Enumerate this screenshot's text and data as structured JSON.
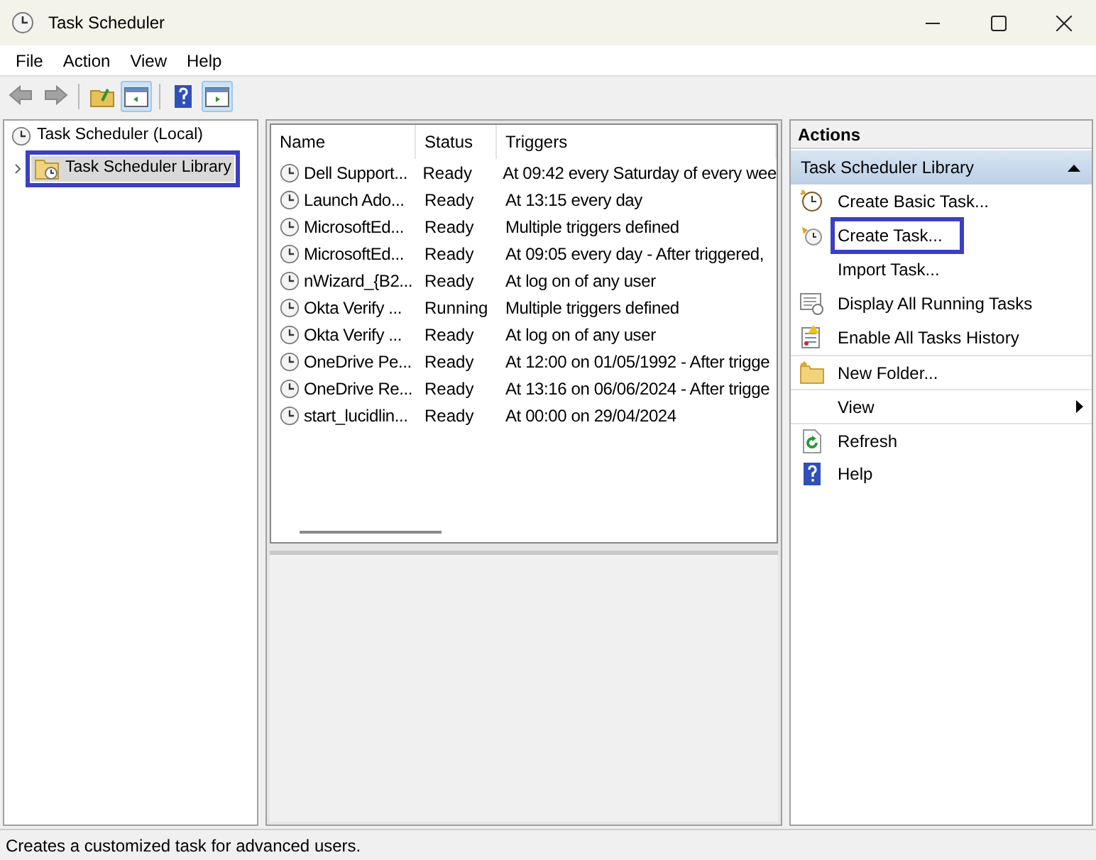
{
  "window": {
    "title": "Task Scheduler"
  },
  "menu": [
    "File",
    "Action",
    "View",
    "Help"
  ],
  "toolbar": [
    {
      "kind": "back",
      "disabled": true
    },
    {
      "kind": "forward",
      "disabled": true
    },
    {
      "kind": "up",
      "disabled": false
    },
    {
      "kind": "pane",
      "disabled": false
    },
    {
      "kind": "help",
      "disabled": false
    },
    {
      "kind": "pane2",
      "disabled": false
    }
  ],
  "tree": [
    {
      "label": "Task Scheduler (Local)",
      "selected": false,
      "highlighted": false,
      "children": [
        {
          "label": "Task Scheduler Library",
          "selected": true,
          "highlighted": true,
          "expanded": false
        }
      ]
    }
  ],
  "tasks": {
    "columns": [
      "Name",
      "Status",
      "Triggers"
    ],
    "rows": [
      {
        "name": "Dell Support...",
        "status": "Ready",
        "triggers": "At 09:42 every Saturday of every wee"
      },
      {
        "name": "Launch Ado...",
        "status": "Ready",
        "triggers": "At 13:15 every day"
      },
      {
        "name": "MicrosoftEd...",
        "status": "Ready",
        "triggers": "Multiple triggers defined"
      },
      {
        "name": "MicrosoftEd...",
        "status": "Ready",
        "triggers": "At 09:05 every day - After triggered,"
      },
      {
        "name": "nWizard_{B2...",
        "status": "Ready",
        "triggers": "At log on of any user"
      },
      {
        "name": "Okta Verify ...",
        "status": "Running",
        "triggers": "Multiple triggers defined"
      },
      {
        "name": "Okta Verify ...",
        "status": "Ready",
        "triggers": "At log on of any user"
      },
      {
        "name": "OneDrive Pe...",
        "status": "Ready",
        "triggers": "At 12:00 on 01/05/1992 - After trigge"
      },
      {
        "name": "OneDrive Re...",
        "status": "Ready",
        "triggers": "At 13:16 on 06/06/2024 - After trigge"
      },
      {
        "name": "start_lucidlin...",
        "status": "Ready",
        "triggers": "At 00:00 on 29/04/2024"
      }
    ]
  },
  "actions": {
    "title": "Actions",
    "section": {
      "title": "Task Scheduler Library",
      "expanded": true
    },
    "items": [
      {
        "label": "Create Basic Task...",
        "kind": "basic",
        "highlighted": false,
        "separator_before": false
      },
      {
        "label": "Create Task...",
        "kind": "task",
        "highlighted": true,
        "separator_before": false
      },
      {
        "label": "Import Task...",
        "kind": "blank",
        "highlighted": false,
        "separator_before": false
      },
      {
        "label": "Display All Running Tasks",
        "kind": "running",
        "highlighted": false,
        "separator_before": false
      },
      {
        "label": "Enable All Tasks History",
        "kind": "history",
        "highlighted": false,
        "separator_before": false
      },
      {
        "label": "New Folder...",
        "kind": "folder",
        "highlighted": false,
        "separator_before": true
      },
      {
        "label": "View",
        "kind": "submenu",
        "highlighted": false,
        "separator_before": true
      },
      {
        "label": "Refresh",
        "kind": "refresh",
        "highlighted": false,
        "separator_before": true
      },
      {
        "label": "Help",
        "kind": "help",
        "highlighted": false,
        "separator_before": false
      }
    ]
  },
  "status_bar": "Creates a customized task for advanced users."
}
